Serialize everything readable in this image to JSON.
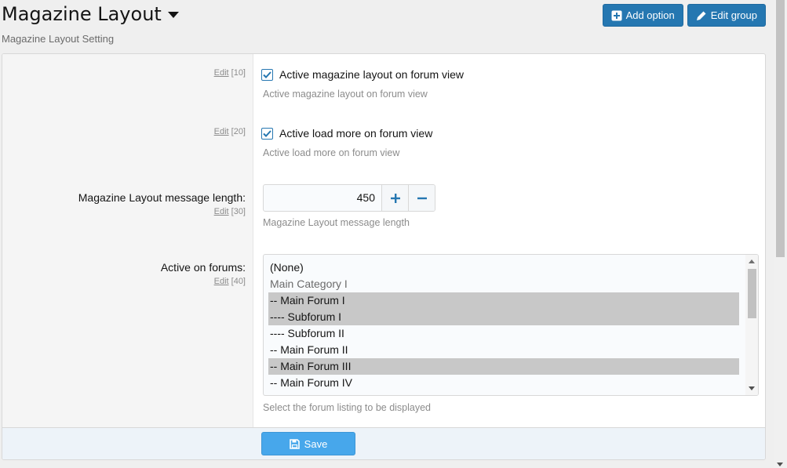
{
  "header": {
    "title": "Magazine Layout",
    "description": "Magazine Layout Setting",
    "add_option_label": "Add option",
    "edit_group_label": "Edit group"
  },
  "options": {
    "opt1": {
      "edit_label": "Edit",
      "order": "[10]",
      "checked": true,
      "label": "Active magazine layout on forum view",
      "hint": "Active magazine layout on forum view"
    },
    "opt2": {
      "edit_label": "Edit",
      "order": "[20]",
      "checked": true,
      "label": "Active load more on forum view",
      "hint": "Active load more on forum view"
    },
    "opt3": {
      "label": "Magazine Layout message length:",
      "edit_label": "Edit",
      "order": "[30]",
      "value": "450",
      "hint": "Magazine Layout message length"
    },
    "opt4": {
      "label": "Active on forums:",
      "edit_label": "Edit",
      "order": "[40]",
      "hint": "Select the forum listing to be displayed",
      "forums": [
        {
          "label": "(None)",
          "selected": false,
          "group": false
        },
        {
          "label": "Main Category I",
          "selected": false,
          "group": true
        },
        {
          "label": "-- Main Forum I",
          "selected": true,
          "group": false
        },
        {
          "label": "---- Subforum I",
          "selected": true,
          "group": false
        },
        {
          "label": "---- Subforum II",
          "selected": false,
          "group": false
        },
        {
          "label": "-- Main Forum II",
          "selected": false,
          "group": false
        },
        {
          "label": "-- Main Forum III",
          "selected": true,
          "group": false
        },
        {
          "label": "-- Main Forum IV",
          "selected": false,
          "group": false
        }
      ]
    }
  },
  "footer": {
    "save_label": "Save"
  },
  "colors": {
    "accent": "#2577b1",
    "save": "#47a7eb",
    "selected": "#c8c8c8"
  }
}
